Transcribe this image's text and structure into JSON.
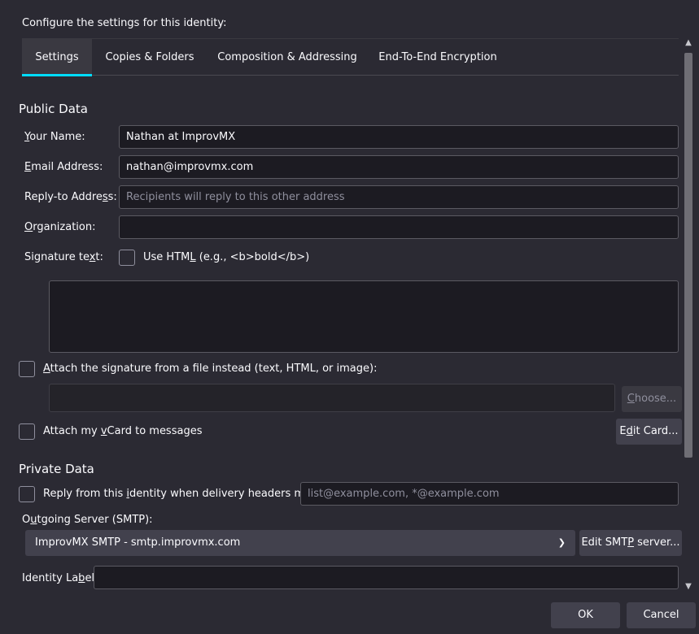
{
  "intro": "Configure the settings for this identity:",
  "tabs": [
    {
      "label": "Settings",
      "active": true
    },
    {
      "label": "Copies & Folders",
      "active": false
    },
    {
      "label": "Composition & Addressing",
      "active": false
    },
    {
      "label": "End-To-End Encryption",
      "active": false
    }
  ],
  "public": {
    "title": "Public Data",
    "name_label_pre": "",
    "name_label_u": "Y",
    "name_label_post": "our Name:",
    "name_value": "Nathan at ImprovMX",
    "email_label_u": "E",
    "email_label_post": "mail Address:",
    "email_value": "nathan@improvmx.com",
    "reply_label_pre": "Reply-to Addre",
    "reply_label_u": "s",
    "reply_label_post": "s:",
    "reply_placeholder": "Recipients will reply to this other address",
    "org_label_u": "O",
    "org_label_post": "rganization:",
    "org_value": "",
    "sig_label_pre": "Signature te",
    "sig_label_u": "x",
    "sig_label_post": "t:",
    "use_html_pre": "Use HTM",
    "use_html_u": "L",
    "use_html_post": " (e.g., <b>bold</b>)",
    "signature_text": "",
    "attach_sig_pre": "",
    "attach_sig_u": "A",
    "attach_sig_post": "ttach the signature from a file instead (text, HTML, or image):",
    "sig_file_value": "",
    "choose_pre": "",
    "choose_u": "C",
    "choose_post": "hoose...",
    "vcard_pre": "Attach my ",
    "vcard_u": "v",
    "vcard_post": "Card to messages",
    "edit_card_pre": "E",
    "edit_card_u": "d",
    "edit_card_post": "it Card..."
  },
  "private": {
    "title": "Private Data",
    "reply_match_pre": "Reply from this ",
    "reply_match_u": "i",
    "reply_match_post": "dentity when delivery headers match:",
    "reply_match_placeholder": "list@example.com, *@example.com",
    "smtp_label_pre": "O",
    "smtp_label_u": "u",
    "smtp_label_post": "tgoing Server (SMTP):",
    "smtp_value": "ImprovMX SMTP - smtp.improvmx.com",
    "edit_smtp_pre": "Edit SMT",
    "edit_smtp_u": "P",
    "edit_smtp_post": " server...",
    "identity_label_pre": "Identity La",
    "identity_label_u": "b",
    "identity_label_post": "el:",
    "identity_value": ""
  },
  "footer": {
    "ok": "OK",
    "cancel": "Cancel"
  },
  "colors": {
    "background": "#2b2a33",
    "field": "#1c1b22",
    "accent": "#00ddff",
    "button": "#42414d"
  }
}
